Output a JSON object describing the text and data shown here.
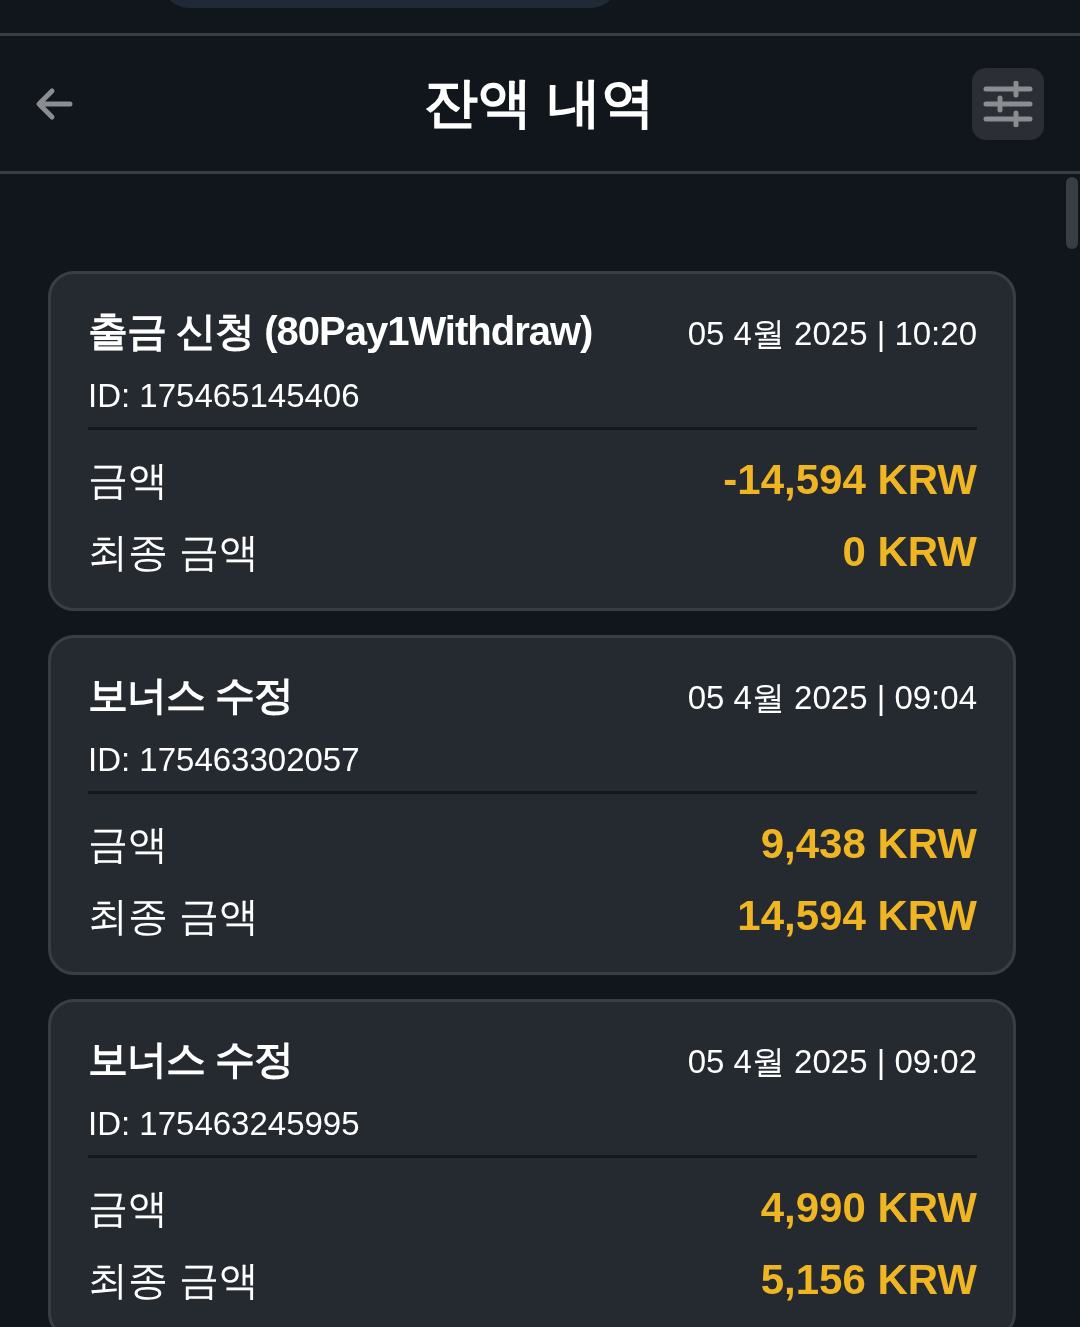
{
  "header": {
    "title": "잔액 내역"
  },
  "transactions": [
    {
      "title": "출금 신청 (80Pay1Withdraw)",
      "date": "05 4월 2025 | 10:20",
      "id": "ID: 175465145406",
      "rows": [
        {
          "label": "금액",
          "value": "-14,594 KRW"
        },
        {
          "label": "최종 금액",
          "value": "0 KRW"
        }
      ]
    },
    {
      "title": "보너스 수정",
      "date": "05 4월 2025 | 09:04",
      "id": "ID: 175463302057",
      "rows": [
        {
          "label": "금액",
          "value": "9,438 KRW"
        },
        {
          "label": "최종 금액",
          "value": "14,594 KRW"
        }
      ]
    },
    {
      "title": "보너스 수정",
      "date": "05 4월 2025 | 09:02",
      "id": "ID: 175463245995",
      "rows": [
        {
          "label": "금액",
          "value": "4,990 KRW"
        },
        {
          "label": "최종 금액",
          "value": "5,156 KRW"
        }
      ]
    }
  ]
}
